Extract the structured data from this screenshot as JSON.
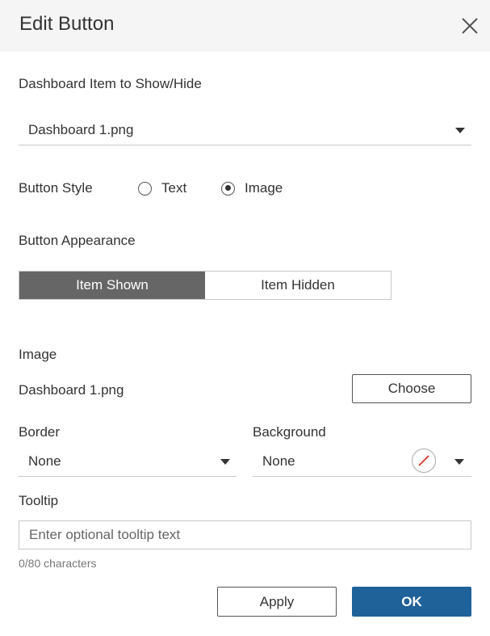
{
  "dialog": {
    "title": "Edit Button",
    "close_icon": "close-icon"
  },
  "target": {
    "label": "Dashboard Item to Show/Hide",
    "value": "Dashboard 1.png"
  },
  "button_style": {
    "label": "Button Style",
    "options": [
      {
        "label": "Text",
        "selected": false
      },
      {
        "label": "Image",
        "selected": true
      }
    ]
  },
  "appearance": {
    "label": "Button Appearance",
    "segments": [
      {
        "label": "Item Shown",
        "active": true
      },
      {
        "label": "Item Hidden",
        "active": false
      }
    ]
  },
  "image": {
    "label": "Image",
    "file": "Dashboard 1.png",
    "choose_label": "Choose"
  },
  "border": {
    "label": "Border",
    "value": "None"
  },
  "background": {
    "label": "Background",
    "value": "None",
    "swatch_icon": "no-color-icon"
  },
  "tooltip": {
    "label": "Tooltip",
    "placeholder": "Enter optional tooltip text",
    "value": "",
    "counter": "0/80 characters"
  },
  "footer": {
    "apply_label": "Apply",
    "ok_label": "OK"
  },
  "colors": {
    "header_bg": "#f5f5f5",
    "active_segment": "#666666",
    "primary": "#1f6199"
  }
}
